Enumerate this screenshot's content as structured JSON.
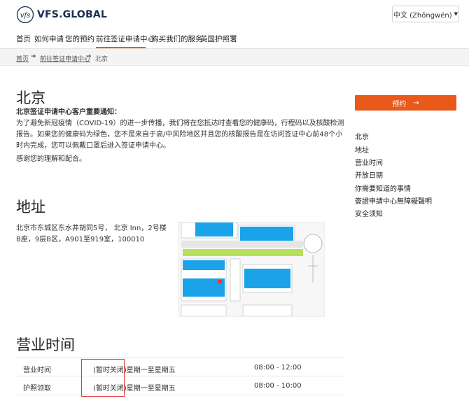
{
  "header": {
    "brand": "VFS.GLOBAL",
    "language_label": "中文 (Zhōngwén)"
  },
  "nav": {
    "items": [
      {
        "label": "首页"
      },
      {
        "label": "如何申请"
      },
      {
        "label": "您的预约"
      },
      {
        "label": "前往签证申请中心"
      },
      {
        "label": "购买我们的服务"
      },
      {
        "label": "英国护照署"
      }
    ],
    "active_index": 3
  },
  "breadcrumb": {
    "items": [
      "首页",
      "前往签证申请中心",
      "北京"
    ]
  },
  "main": {
    "title": "北京",
    "notice_heading": "北京签证申请中心客户重要通知：",
    "notice_lines": [
      "为了避免新冠疫情（COVID-19）的进一步传播，我们将在您抵达时查看您的健康码，行程码以及核酸检测",
      "报告。如果您的健康码为绿色，您不是来自于高/中风险地区并且您的核酸报告是在访问签证中心前48个小",
      "时内完成，您可以佩戴口罩后进入签证申请中心。"
    ],
    "thanks": "感谢您的理解和配合。",
    "address_title": "地址",
    "address_lines": [
      "北京市东城区东水井胡同5号， 北京 Inn，2号楼",
      "B座，9层B区，A901至919室，100010"
    ],
    "hours_title": "营业时间",
    "hours": [
      {
        "label": "营业时间",
        "days": "(暂时关闭)星期一至星期五",
        "time": "08:00 - 12:00"
      },
      {
        "label": "护照领取",
        "days": "(暂时关闭)星期一至星期五",
        "time": "08:00 - 10:00"
      }
    ]
  },
  "sidebar": {
    "book_label": "预约",
    "links": [
      "北京",
      "地址",
      "营业时间",
      "开放日期",
      "你需要知道的事情",
      "簽證申請中心無障礙聲明",
      "安全须知"
    ]
  },
  "colors": {
    "accent": "#e8591a",
    "map_blue": "#1aa3e8",
    "map_green": "#b6e05a",
    "highlight_red": "#e23a3a"
  }
}
